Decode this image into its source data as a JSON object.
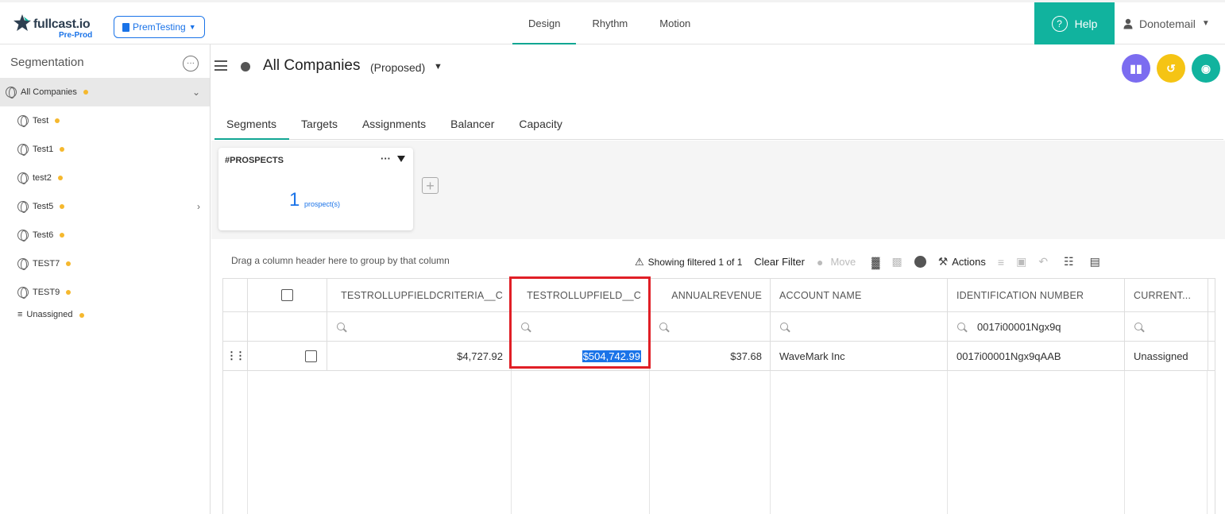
{
  "app": {
    "logo_name": "fullcast.io",
    "logo_env": "Pre-Prod",
    "workspace": "PremTesting",
    "nav": [
      "Design",
      "Rhythm",
      "Motion"
    ],
    "help_label": "Help",
    "user": "Donotemail",
    "accent_color": "#11b39e"
  },
  "sidebar": {
    "title": "Segmentation",
    "items": [
      {
        "label": "All Companies"
      },
      {
        "label": "Test"
      },
      {
        "label": "Test1"
      },
      {
        "label": "test2"
      },
      {
        "label": "Test5"
      },
      {
        "label": "Test6"
      },
      {
        "label": "TEST7"
      },
      {
        "label": "TEST9"
      },
      {
        "label": "Unassigned"
      }
    ]
  },
  "header": {
    "title": "All Companies",
    "scenario": "(Proposed)",
    "tabs": [
      "Segments",
      "Targets",
      "Assignments",
      "Balancer",
      "Capacity"
    ]
  },
  "segment": {
    "name": "#PROSPECTS",
    "count": "1",
    "unit": "prospect(s)"
  },
  "toolbar": {
    "drag_hint": "Drag a column header here to group by that column",
    "filter_status": "Showing filtered 1 of 1",
    "clear_filter": "Clear Filter",
    "move": "Move",
    "actions": "Actions"
  },
  "grid": {
    "columns": [
      "TESTROLLUPFIELDCRITERIA__C",
      "TESTROLLUPFIELD__C",
      "ANNUALREVENUE",
      "ACCOUNT NAME",
      "IDENTIFICATION NUMBER",
      "CURRENT..."
    ],
    "filter_identification": "0017i00001Ngx9q",
    "rows": [
      {
        "criteria": "$4,727.92",
        "rollup": "$504,742.99",
        "annual_revenue": "$37.68",
        "account_name": "WaveMark Inc",
        "identification_number": "0017i00001Ngx9qAAB",
        "current": "Unassigned"
      }
    ]
  }
}
